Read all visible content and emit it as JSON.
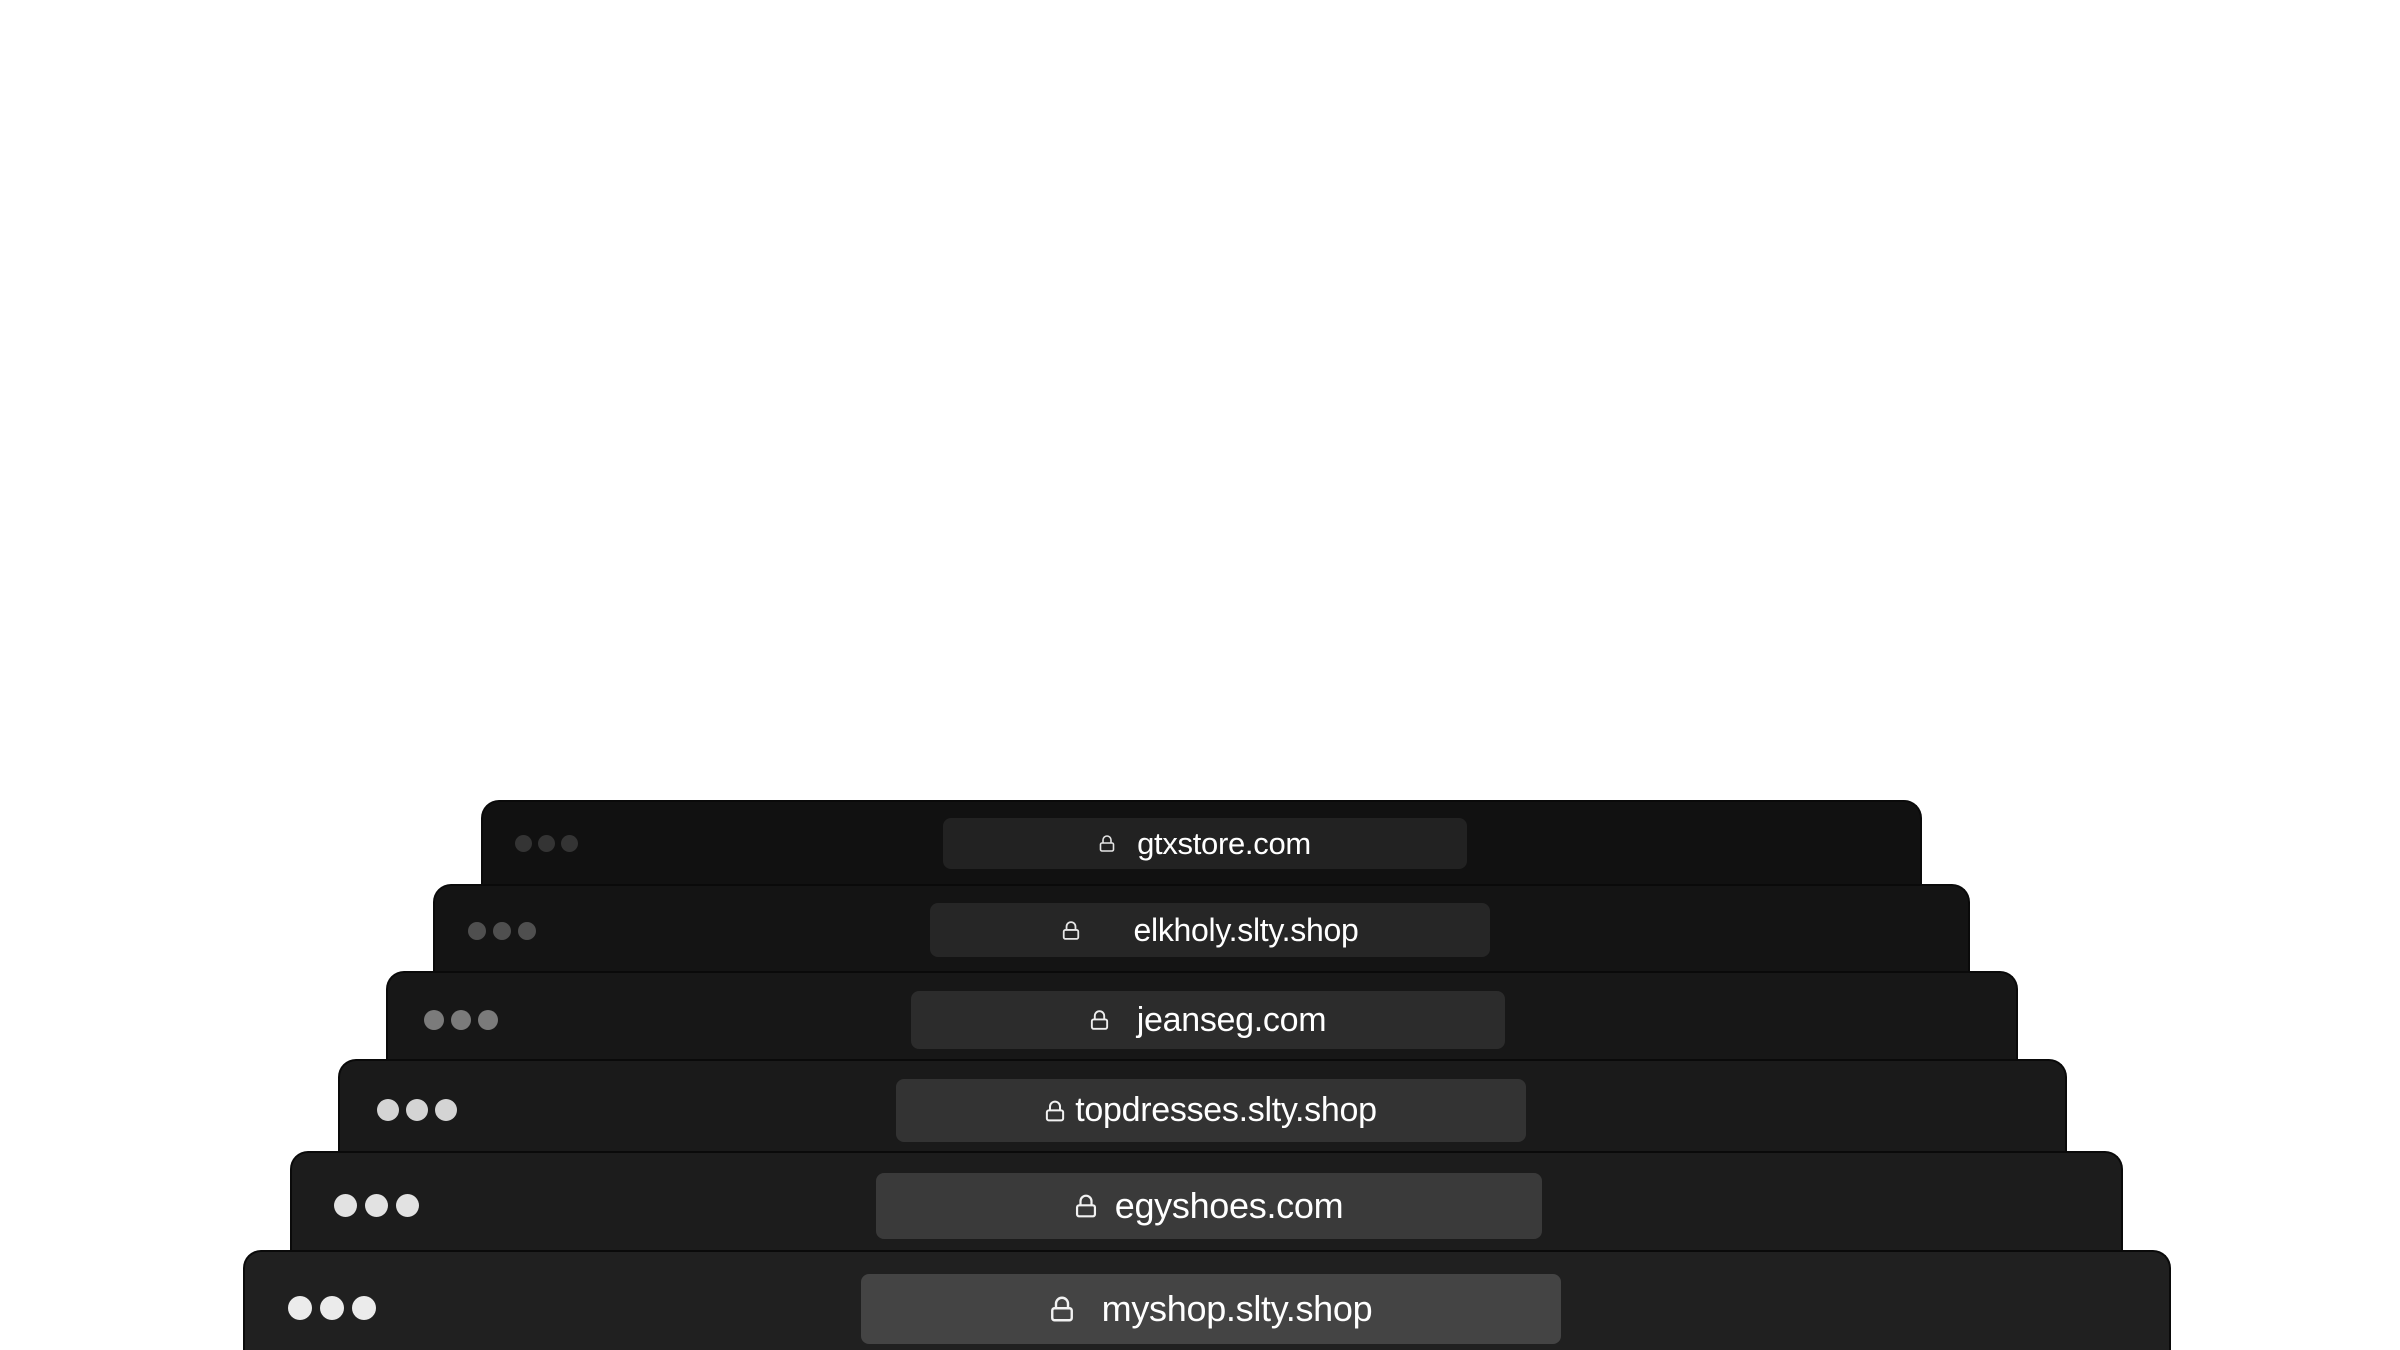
{
  "windows": [
    {
      "id": "w1",
      "url": "gtxstore.com"
    },
    {
      "id": "w2",
      "url": "elkholy.slty.shop"
    },
    {
      "id": "w3",
      "url": "jeanseg.com"
    },
    {
      "id": "w4",
      "url": "topdresses.slty.shop"
    },
    {
      "id": "w5",
      "url": "egyshoes.com"
    },
    {
      "id": "w6",
      "url": "myshop.slty.shop"
    }
  ],
  "icons": {
    "window_controls": "traffic-light-dots",
    "url_prefix": "lock-icon"
  },
  "colors": {
    "background": "#ffffff",
    "window_frames": [
      "#111111",
      "#141414",
      "#171717",
      "#1a1a1a",
      "#1c1c1c",
      "#202020"
    ],
    "url_bars": [
      "#222222",
      "#262626",
      "#2c2c2c",
      "#333333",
      "#3a3a3a",
      "#444444"
    ],
    "url_text": "#ffffff"
  }
}
